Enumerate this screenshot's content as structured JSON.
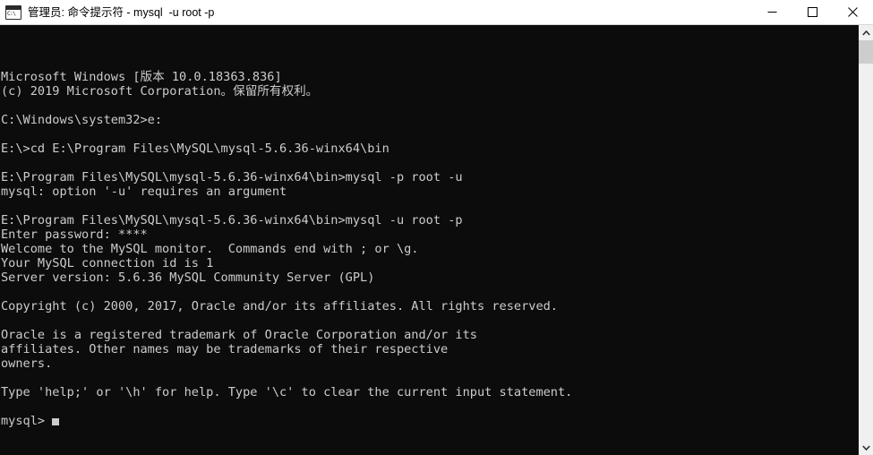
{
  "window": {
    "title": "管理员: 命令提示符 - mysql  -u root -p",
    "icon_name": "console-icon",
    "icon_label": "C:\\",
    "colors": {
      "console_background": "#0c0c0c",
      "console_foreground": "#cccccc",
      "titlebar_background": "#ffffff",
      "scrollbar_track": "#f0f0f0",
      "scrollbar_thumb": "#cdcdcd"
    }
  },
  "titlebar_buttons": {
    "minimize_label": "最小化",
    "maximize_label": "最大化",
    "close_label": "关闭"
  },
  "scrollbar": {
    "up_label": "向上滚动",
    "down_label": "向下滚动",
    "thumb_label": "滚动条滑块"
  },
  "console": {
    "prompt": "mysql>",
    "cursor": "block",
    "lines": [
      "Microsoft Windows [版本 10.0.18363.836]",
      "(c) 2019 Microsoft Corporation。保留所有权利。",
      "",
      "C:\\Windows\\system32>e:",
      "",
      "E:\\>cd E:\\Program Files\\MySQL\\mysql-5.6.36-winx64\\bin",
      "",
      "E:\\Program Files\\MySQL\\mysql-5.6.36-winx64\\bin>mysql -p root -u",
      "mysql: option '-u' requires an argument",
      "",
      "E:\\Program Files\\MySQL\\mysql-5.6.36-winx64\\bin>mysql -u root -p",
      "Enter password: ****",
      "Welcome to the MySQL monitor.  Commands end with ; or \\g.",
      "Your MySQL connection id is 1",
      "Server version: 5.6.36 MySQL Community Server (GPL)",
      "",
      "Copyright (c) 2000, 2017, Oracle and/or its affiliates. All rights reserved.",
      "",
      "Oracle is a registered trademark of Oracle Corporation and/or its",
      "affiliates. Other names may be trademarks of their respective",
      "owners.",
      "",
      "Type 'help;' or '\\h' for help. Type '\\c' to clear the current input statement.",
      ""
    ]
  }
}
